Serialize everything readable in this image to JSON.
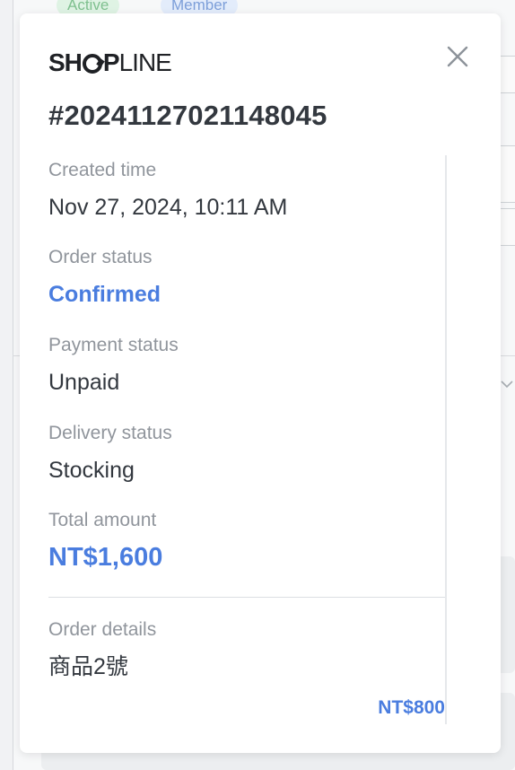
{
  "background": {
    "tags": [
      "Active",
      "Member"
    ]
  },
  "modal": {
    "brand": {
      "logo_bold": "SH",
      "logo_bold_after": "P",
      "logo_light": "LINE"
    },
    "close_icon": "close-icon",
    "order_number": "#20241127021148045",
    "fields": [
      {
        "label": "Created time",
        "value": "Nov 27, 2024, 10:11 AM"
      },
      {
        "label": "Order status",
        "value": "Confirmed"
      },
      {
        "label": "Payment status",
        "value": "Unpaid"
      },
      {
        "label": "Delivery status",
        "value": "Stocking"
      },
      {
        "label": "Total amount",
        "value": "NT$1,600"
      }
    ],
    "order_details": {
      "label": "Order details",
      "item_name": "商品2號",
      "item_price": "NT$800"
    }
  },
  "colors": {
    "accent": "#4a7ddf",
    "label": "#90959c",
    "text": "#33383f"
  }
}
